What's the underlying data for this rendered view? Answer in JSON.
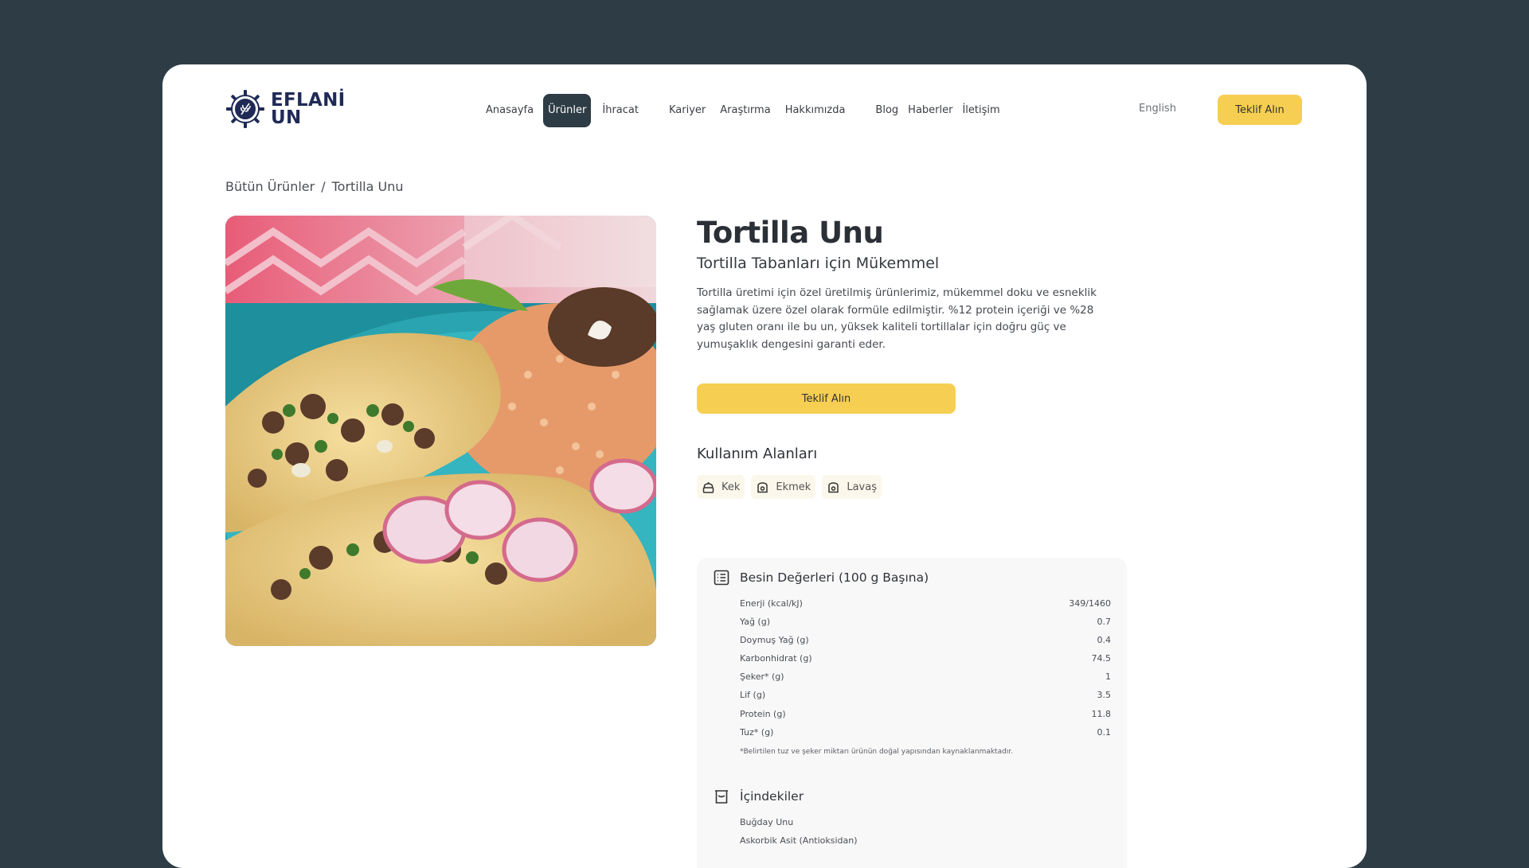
{
  "brand": {
    "line1": "EFLANİ",
    "line2": "UN"
  },
  "nav": {
    "items": [
      {
        "label": "Anasayfa",
        "active": false
      },
      {
        "label": "Ürünler",
        "active": true
      },
      {
        "label": "İhracat",
        "active": false
      },
      {
        "label": "Kariyer",
        "active": false
      },
      {
        "label": "Araştırma",
        "active": false
      },
      {
        "label": "Hakkımızda",
        "active": false
      },
      {
        "label": "Blog",
        "active": false
      },
      {
        "label": "Haberler",
        "active": false
      },
      {
        "label": "İletişim",
        "active": false
      }
    ],
    "language": "English",
    "quote_button": "Teklif Alın"
  },
  "breadcrumb": {
    "parent": "Bütün Ürünler",
    "separator": "/",
    "current": "Tortilla Unu"
  },
  "product": {
    "title": "Tortilla Unu",
    "subtitle": "Tortilla Tabanları için Mükemmel",
    "description": "Tortilla üretimi için özel üretilmiş ürünlerimiz, mükemmel doku ve esneklik sağlamak üzere özel olarak formüle edilmiştir. %12 protein içeriği ve %28 yaş gluten oranı ile bu un, yüksek kaliteli tortillalar için doğru güç ve yumuşaklık dengesini garanti eder.",
    "quote_button": "Teklif Alın",
    "usage_title": "Kullanım Alanları",
    "usage": [
      {
        "label": "Kek",
        "icon": "cake-icon"
      },
      {
        "label": "Ekmek",
        "icon": "bread-icon"
      },
      {
        "label": "Lavaş",
        "icon": "bread-icon"
      }
    ]
  },
  "nutrition": {
    "title": "Besin Değerleri (100 g Başına)",
    "rows": [
      {
        "label": "Enerji (kcal/kJ)",
        "value": "349/1460"
      },
      {
        "label": "Yağ (g)",
        "value": "0.7"
      },
      {
        "label": "Doymuş Yağ (g)",
        "value": "0.4"
      },
      {
        "label": "Karbonhidrat (g)",
        "value": "74.5"
      },
      {
        "label": "Şeker* (g)",
        "value": "1"
      },
      {
        "label": "Lif (g)",
        "value": "3.5"
      },
      {
        "label": "Protein (g)",
        "value": "11.8"
      },
      {
        "label": "Tuz* (g)",
        "value": "0.1"
      }
    ],
    "footnote": "*Belirtilen tuz ve şeker miktarı ürünün doğal yapısından kaynaklanmaktadır."
  },
  "ingredients": {
    "title": "İçindekiler",
    "items": [
      "Buğday Unu",
      "Askorbik Asit (Antioksidan)"
    ]
  },
  "colors": {
    "background": "#2e3c45",
    "accent": "#f6cf52",
    "brand": "#1f2a56"
  }
}
